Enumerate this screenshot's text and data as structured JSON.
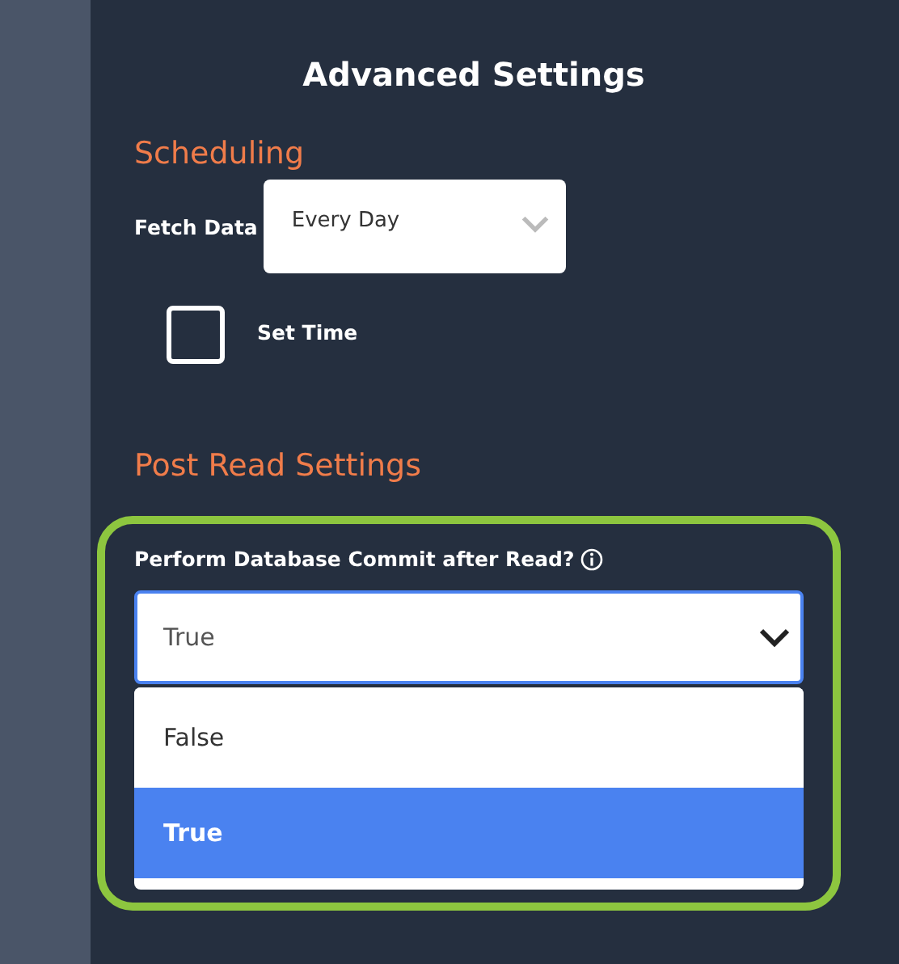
{
  "title": "Advanced Settings",
  "scheduling": {
    "heading": "Scheduling",
    "fetch_label": "Fetch Data",
    "fetch_value": "Every Day",
    "set_time": {
      "label": "Set Time",
      "checked": false
    }
  },
  "post_read": {
    "heading": "Post Read Settings",
    "label": "Perform Database Commit after Read?",
    "value": "True",
    "expanded": true,
    "options": [
      {
        "label": "False",
        "selected": false
      },
      {
        "label": "True",
        "selected": true
      }
    ]
  }
}
